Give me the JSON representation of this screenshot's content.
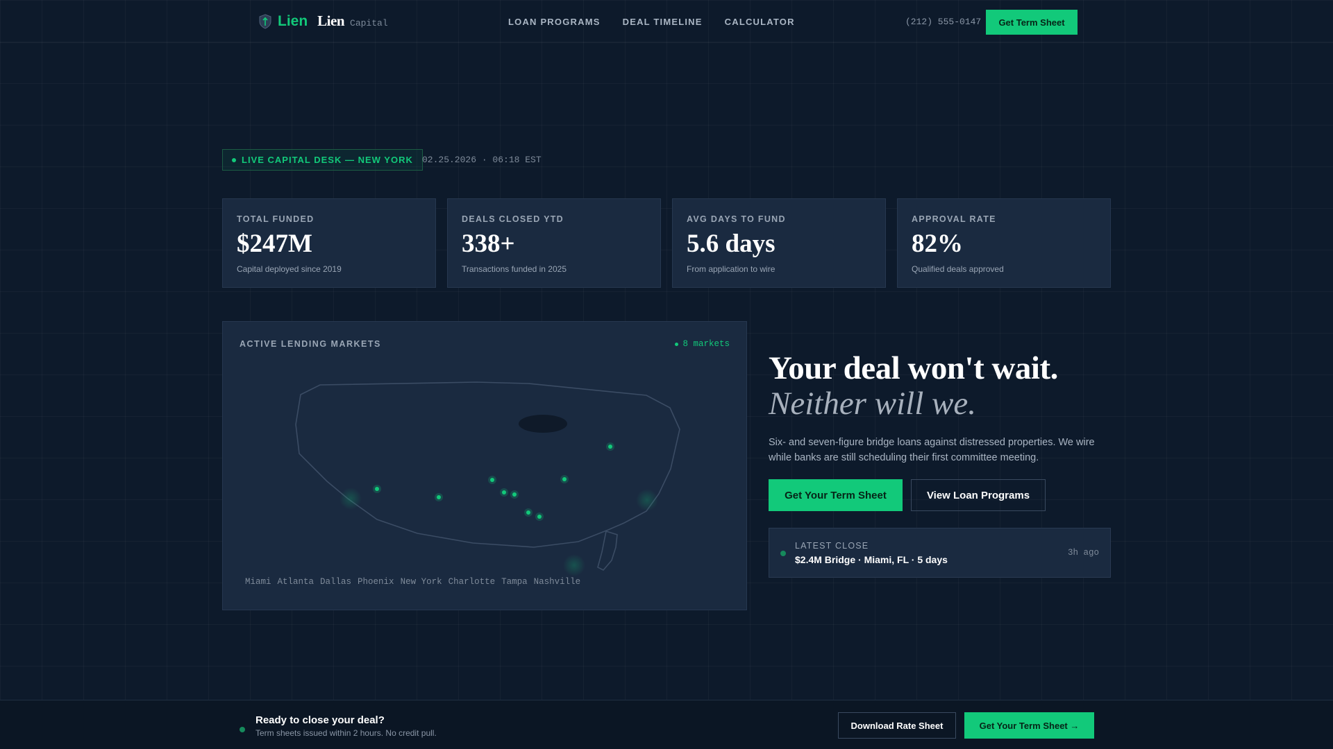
{
  "nav": {
    "brand": "Lien",
    "wordmark": "Lien",
    "sub": "Capital",
    "links": [
      "LOAN PROGRAMS",
      "DEAL TIMELINE",
      "CALCULATOR"
    ],
    "phone": "(212) 555-0147",
    "cta": "Get Term Sheet"
  },
  "status": {
    "badge": "LIVE CAPITAL DESK — NEW YORK",
    "datetime": "02.25.2026 · 06:18 EST"
  },
  "stats": [
    {
      "label": "TOTAL FUNDED",
      "value": "$247M",
      "desc": "Capital deployed since 2019"
    },
    {
      "label": "DEALS CLOSED YTD",
      "value": "338+",
      "desc": "Transactions funded in 2025"
    },
    {
      "label": "AVG DAYS TO FUND",
      "value": "5.6 days",
      "desc": "From application to wire"
    },
    {
      "label": "APPROVAL RATE",
      "value": "82%",
      "desc": "Qualified deals approved"
    }
  ],
  "map": {
    "title": "ACTIVE LENDING MARKETS",
    "count": "8 markets",
    "cities": [
      "Miami",
      "Atlanta",
      "Dallas",
      "Phoenix",
      "New York",
      "Charlotte",
      "Tampa",
      "Nashville"
    ]
  },
  "hero": {
    "headline": "Your deal won't wait.",
    "subheadline": "Neither will we.",
    "body": "Six- and seven-figure bridge loans against distressed properties. We wire while banks are still scheduling their first committee meeting.",
    "primary_cta": "Get Your Term Sheet",
    "secondary_cta": "View Loan Programs"
  },
  "latest": {
    "label": "LATEST CLOSE",
    "value": "$2.4M Bridge · Miami, FL · 5 days",
    "time": "3h ago"
  },
  "footer": {
    "title": "Ready to close your deal?",
    "subtitle": "Term sheets issued within 2 hours. No credit pull.",
    "download": "Download Rate Sheet",
    "cta": "Get Your Term Sheet →"
  },
  "colors": {
    "accent": "#12c97a",
    "background": "#0d1a2b",
    "card": "#1a2a40"
  }
}
